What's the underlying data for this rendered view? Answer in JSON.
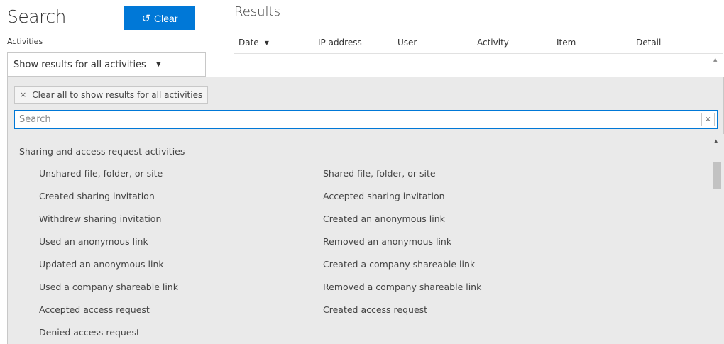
{
  "left": {
    "title": "Search",
    "clear_label": "Clear",
    "activities_label": "Activities",
    "activities_value": "Show results for all activities"
  },
  "results": {
    "title": "Results",
    "columns": [
      "Date",
      "IP address",
      "User",
      "Activity",
      "Item",
      "Detail"
    ]
  },
  "dropdown": {
    "chip_label": "Clear all to show results for all activities",
    "search_placeholder": "Search",
    "group_title": "Sharing and access request activities",
    "items_col1": [
      "Unshared file, folder, or site",
      "Created sharing invitation",
      "Withdrew sharing invitation",
      "Used an anonymous link",
      "Updated an anonymous link",
      "Used a company shareable link",
      "Accepted access request",
      "Denied access request"
    ],
    "items_col2": [
      "Shared file, folder, or site",
      "Accepted sharing invitation",
      "Created an anonymous link",
      "Removed an anonymous link",
      "Created a company shareable link",
      "Removed a company shareable link",
      "Created access request"
    ]
  },
  "colors": {
    "accent": "#0078d7",
    "panel_bg": "#eaeaea",
    "border": "#c8c8c8"
  }
}
